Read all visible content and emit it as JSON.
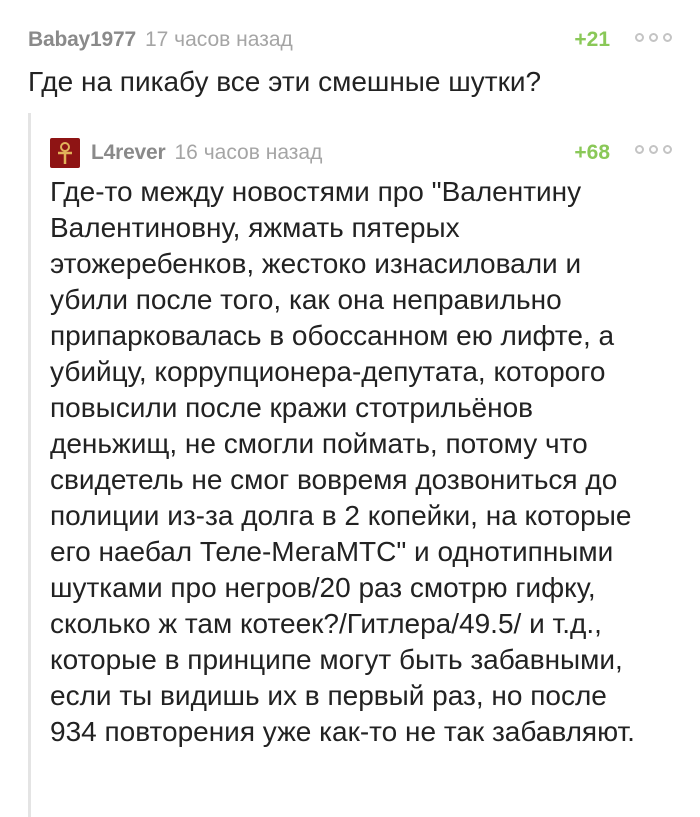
{
  "parent_comment": {
    "author": "Babay1977",
    "timestamp": "17 часов назад",
    "rating": "+21",
    "text": "Где на пикабу все эти смешные шутки?"
  },
  "reply_comment": {
    "author": "L4rever",
    "timestamp": "16 часов назад",
    "rating": "+68",
    "avatar_icon": "ankh-avatar-icon",
    "lines": [
      "Где-то между новостями про \"Валентину",
      "Валентиновну, яжмать пятерых",
      "этожеребенков, жестоко изнасиловали и",
      "убили после того, как она неправильно",
      "припарковалась в обоссанном ею лифте, а",
      "убийцу, коррупционера-депутата, которого",
      "повысили после кражи стотрильёнов",
      "деньжищ, не смогли поймать, потому что",
      "свидетель не смог вовремя дозвониться до",
      "полиции из-за долга в 2 копейки, на которые",
      "его наебал Теле-МегаМТС\" и однотипными",
      "шутками про негров/20 раз смотрю гифку,",
      "сколько ж там котеек?/Гитлера/49.5/ и т.д.,",
      "которые в принципе могут быть забавными,",
      "если ты видишь их в первый раз, но после",
      "934 повторения уже как-то не так забавляют."
    ]
  },
  "colors": {
    "rating": "#8ac858",
    "username": "#8a8a8a",
    "timestamp": "#a5a5a5",
    "text": "#222222",
    "branch_line": "#e4e4e4"
  }
}
